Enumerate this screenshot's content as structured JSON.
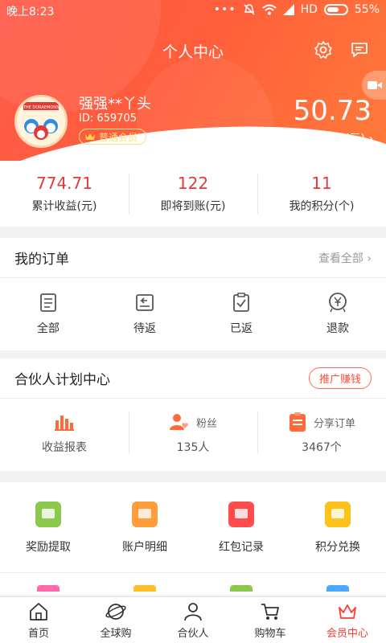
{
  "status": {
    "time": "晚上8:23",
    "dots": "•••",
    "network": "HD",
    "battery": "55%"
  },
  "header": {
    "title": "个人中心"
  },
  "user": {
    "name": "强强**丫头",
    "id": "ID: 659705",
    "level": "普通会员",
    "avatar_text": "THE DORAEMONS"
  },
  "balance": {
    "value": "50.73",
    "label": "账户余额 (元) ›"
  },
  "stats": [
    {
      "value": "774.71",
      "label": "累计收益(元)"
    },
    {
      "value": "122",
      "label": "即将到账(元)"
    },
    {
      "value": "11",
      "label": "我的积分(个)"
    }
  ],
  "orders": {
    "title": "我的订单",
    "more": "查看全部 ›",
    "items": [
      {
        "label": "全部",
        "icon": "clipboard-icon"
      },
      {
        "label": "待返",
        "icon": "return-icon"
      },
      {
        "label": "已返",
        "icon": "check-clipboard-icon"
      },
      {
        "label": "退款",
        "icon": "refund-icon"
      }
    ]
  },
  "partner": {
    "title": "合伙人计划中心",
    "promo": "推广赚钱",
    "items": [
      {
        "top": "",
        "sub": "收益报表"
      },
      {
        "top": "粉丝",
        "sub": "135人"
      },
      {
        "top": "分享订单",
        "sub": "3467个"
      }
    ]
  },
  "tools": [
    {
      "label": "奖励提取",
      "color": "#8cc84b"
    },
    {
      "label": "账户明细",
      "color": "#ff9d3a"
    },
    {
      "label": "红包记录",
      "color": "#ff4b4b"
    },
    {
      "label": "积分兑换",
      "color": "#ffc21a"
    }
  ],
  "tabs": [
    {
      "label": "首页"
    },
    {
      "label": "全球购"
    },
    {
      "label": "合伙人"
    },
    {
      "label": "购物车"
    },
    {
      "label": "会员中心"
    }
  ],
  "colors": {
    "accent": "#ff3b30",
    "value_red": "#e5383b"
  }
}
